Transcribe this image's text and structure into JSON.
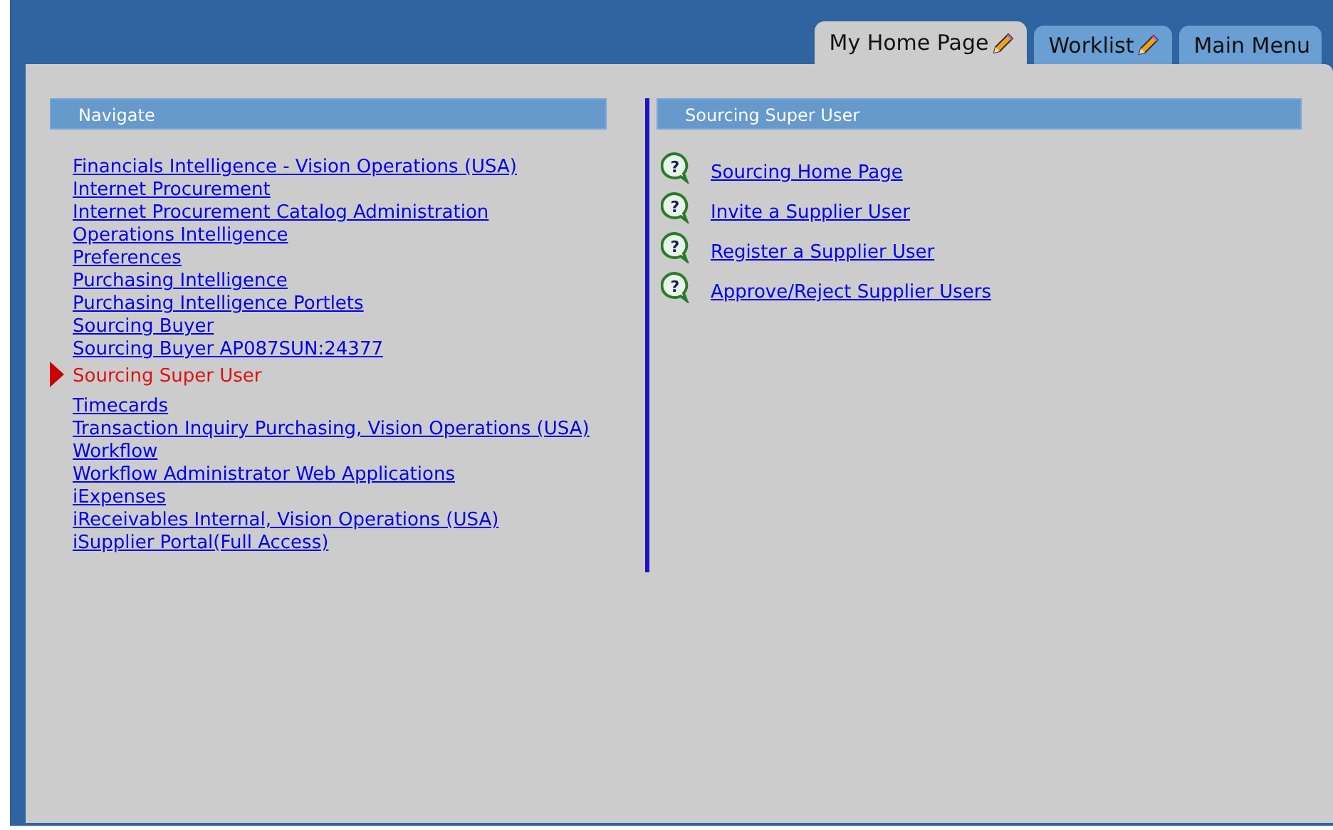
{
  "tabs": [
    {
      "label": "My Home Page",
      "pencil": true,
      "selected": true
    },
    {
      "label": "Worklist",
      "pencil": true,
      "selected": false
    },
    {
      "label": "Main Menu",
      "pencil": false,
      "selected": false
    }
  ],
  "navigate": {
    "title": "Navigate",
    "items": [
      {
        "label": "Financials Intelligence - Vision Operations (USA)",
        "selected": false
      },
      {
        "label": "Internet Procurement",
        "selected": false
      },
      {
        "label": "Internet Procurement Catalog Administration",
        "selected": false
      },
      {
        "label": "Operations Intelligence",
        "selected": false
      },
      {
        "label": "Preferences",
        "selected": false
      },
      {
        "label": "Purchasing Intelligence",
        "selected": false
      },
      {
        "label": "Purchasing Intelligence Portlets",
        "selected": false
      },
      {
        "label": "Sourcing Buyer",
        "selected": false
      },
      {
        "label": "Sourcing Buyer AP087SUN:24377",
        "selected": false
      },
      {
        "label": "Sourcing Super User",
        "selected": true
      },
      {
        "label": "Timecards",
        "selected": false
      },
      {
        "label": "Transaction Inquiry Purchasing, Vision Operations (USA)",
        "selected": false
      },
      {
        "label": "Workflow",
        "selected": false
      },
      {
        "label": "Workflow Administrator Web Applications",
        "selected": false
      },
      {
        "label": "iExpenses",
        "selected": false
      },
      {
        "label": "iReceivables Internal, Vision Operations (USA)",
        "selected": false
      },
      {
        "label": "iSupplier Portal(Full Access)",
        "selected": false
      }
    ]
  },
  "functions": {
    "title": "Sourcing Super User",
    "items": [
      {
        "icon": "?",
        "label": "Sourcing Home Page"
      },
      {
        "icon": "?",
        "label": "Invite a Supplier User"
      },
      {
        "icon": "?",
        "label": "Register a Supplier User"
      },
      {
        "icon": "?",
        "label": "Approve/Reject Supplier Users"
      }
    ]
  }
}
